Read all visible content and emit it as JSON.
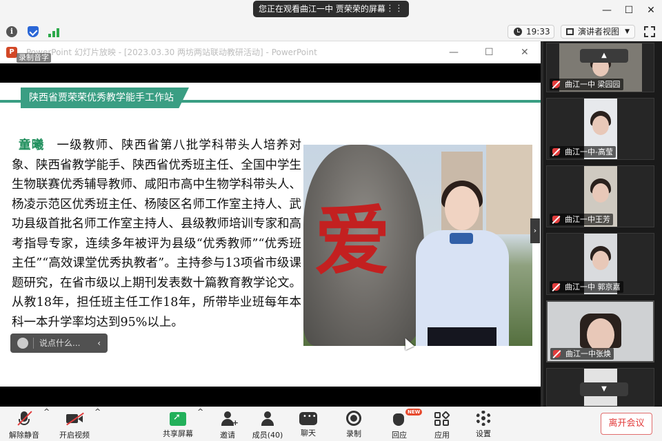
{
  "share_banner": {
    "text": "您正在观看曲江一中 贾荣荣的屏幕",
    "menu_icon": "more-icon"
  },
  "window_controls": {
    "minimize": "—",
    "maximize": "☐",
    "close": "✕"
  },
  "toolbar_top": {
    "time": "19:33",
    "view_mode": "演讲者视图"
  },
  "ppt": {
    "window_title": "PowerPoint 幻灯片放映 - [2023.03.30  两坊两站联动教研活动] - PowerPoint",
    "recording_badge": "录制音字",
    "minimize": "—",
    "maximize": "☐",
    "close": "✕"
  },
  "slide": {
    "band_title": "陕西省贾荣荣优秀教学能手工作站",
    "name": "童曦",
    "bio": "一级教师、陕西省第八批学科带头人培养对象、陕西省教学能手、陕西省优秀班主任、全国中学生生物联赛优秀辅导教师、咸阳市高中生物学科带头人、杨凌示范区优秀班主任、杨陵区名师工作室主持人、武功县级首批名师工作室主持人、县级教师培训专家和高考指导专家，连续多年被评为县级“优秀教师”“优秀班主任”“高效课堂优秀执教者”。主持参与13项省市级课题研究，在省市级以上期刊发表数十篇教育教学论文。从教18年，担任班主任工作18年，所带毕业班每年本科一本升学率均达到95%以上。",
    "photo_char": "爱"
  },
  "chat_widget": {
    "placeholder": "说点什么..."
  },
  "participants": [
    {
      "name": "曲江一中 梁园园"
    },
    {
      "name": "曲江一中-高莹"
    },
    {
      "name": "曲江一中王芳"
    },
    {
      "name": "曲江一中 郭京嘉"
    },
    {
      "name": "曲江一中张焕"
    }
  ],
  "bottom_toolbar": {
    "mute": "解除静音",
    "video": "开启视频",
    "share": "共享屏幕",
    "invite": "邀请",
    "members": "成员(40)",
    "chat": "聊天",
    "record": "录制",
    "react": "回应",
    "react_badge": "NEW",
    "apps": "应用",
    "settings": "设置",
    "leave": "离开会议"
  },
  "colors": {
    "accent_green": "#3a9e83",
    "name_green": "#1f8e5c",
    "leave_red": "#e23c3c"
  }
}
